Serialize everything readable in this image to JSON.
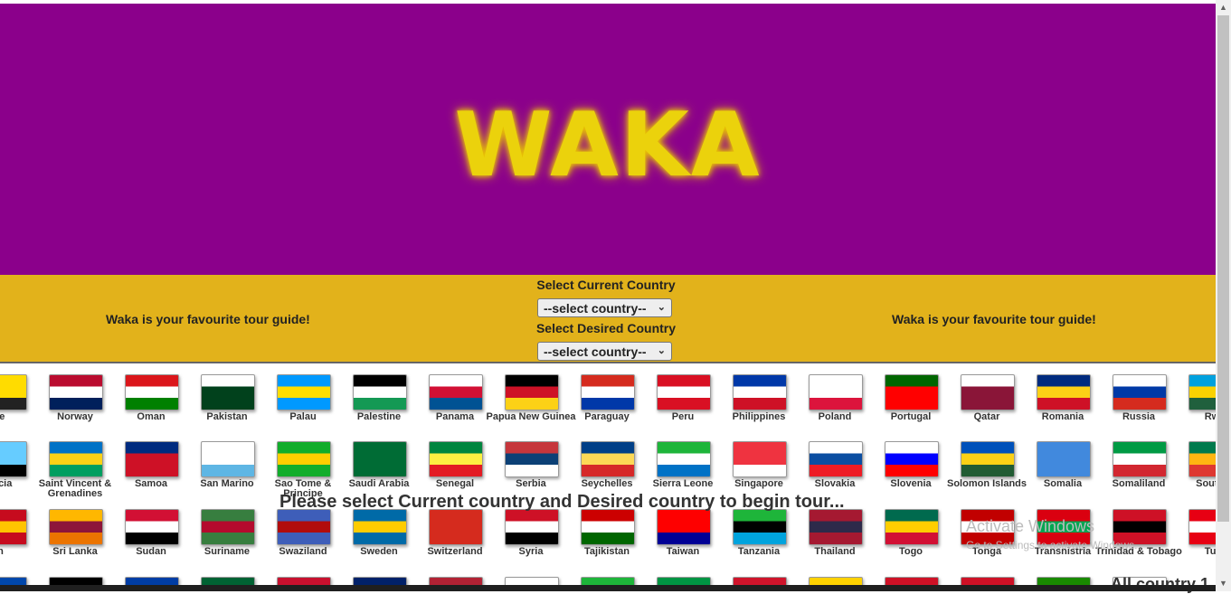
{
  "banner": {
    "logo": "WAKA",
    "background": "#8b008b",
    "logo_color": "#ebd20c"
  },
  "bar": {
    "tagline_left": "Waka is your favourite tour guide!",
    "tagline_right": "Waka is your favourite tour guide!",
    "current_label": "Select Current Country",
    "current_value": "--select country--",
    "desired_label": "Select Desired Country",
    "desired_value": "--select country--",
    "background": "#e2b21b"
  },
  "rows": [
    [
      {
        "name": "ue",
        "colors": [
          "#ffdc00",
          "#ffdc00",
          "#222"
        ]
      },
      {
        "name": "Norway",
        "colors": [
          "#ba0c2f",
          "#ffffff",
          "#00205b"
        ]
      },
      {
        "name": "Oman",
        "colors": [
          "#db161b",
          "#ffffff",
          "#008000"
        ]
      },
      {
        "name": "Pakistan",
        "colors": [
          "#ffffff",
          "#01411c",
          "#01411c"
        ]
      },
      {
        "name": "Palau",
        "colors": [
          "#0099ff",
          "#ffde00",
          "#0099ff"
        ]
      },
      {
        "name": "Palestine",
        "colors": [
          "#000000",
          "#ffffff",
          "#149954"
        ]
      },
      {
        "name": "Panama",
        "colors": [
          "#ffffff",
          "#d21034",
          "#005293"
        ]
      },
      {
        "name": "Papua New Guinea",
        "colors": [
          "#000000",
          "#ce1126",
          "#fcd116"
        ]
      },
      {
        "name": "Paraguay",
        "colors": [
          "#d52b1e",
          "#ffffff",
          "#0038a8"
        ]
      },
      {
        "name": "Peru",
        "colors": [
          "#d91023",
          "#ffffff",
          "#d91023"
        ]
      },
      {
        "name": "Philippines",
        "colors": [
          "#0038a8",
          "#ffffff",
          "#ce1126"
        ]
      },
      {
        "name": "Poland",
        "colors": [
          "#ffffff",
          "#ffffff",
          "#dc143c"
        ]
      },
      {
        "name": "Portugal",
        "colors": [
          "#006600",
          "#ff0000",
          "#ff0000"
        ]
      },
      {
        "name": "Qatar",
        "colors": [
          "#ffffff",
          "#8a1538",
          "#8a1538"
        ]
      },
      {
        "name": "Romania",
        "colors": [
          "#002b7f",
          "#fcd116",
          "#ce1126"
        ]
      },
      {
        "name": "Russia",
        "colors": [
          "#ffffff",
          "#0039a6",
          "#d52b1e"
        ]
      },
      {
        "name": "Rwa",
        "colors": [
          "#00a1de",
          "#fad201",
          "#20603d"
        ]
      }
    ],
    [
      {
        "name": "Lucia",
        "colors": [
          "#66ccff",
          "#66ccff",
          "#000"
        ]
      },
      {
        "name": "Saint Vincent & Grenadines",
        "colors": [
          "#0072c6",
          "#fcd116",
          "#009e60"
        ]
      },
      {
        "name": "Samoa",
        "colors": [
          "#002b7f",
          "#ce1126",
          "#ce1126"
        ]
      },
      {
        "name": "San Marino",
        "colors": [
          "#ffffff",
          "#ffffff",
          "#5eb6e4"
        ]
      },
      {
        "name": "Sao Tome & Principe",
        "colors": [
          "#12ad2b",
          "#ffce00",
          "#12ad2b"
        ]
      },
      {
        "name": "Saudi Arabia",
        "colors": [
          "#006c35",
          "#006c35",
          "#006c35"
        ]
      },
      {
        "name": "Senegal",
        "colors": [
          "#00853f",
          "#fdef42",
          "#e31b23"
        ]
      },
      {
        "name": "Serbia",
        "colors": [
          "#c6363c",
          "#0c4076",
          "#ffffff"
        ]
      },
      {
        "name": "Seychelles",
        "colors": [
          "#003f87",
          "#fcd856",
          "#d62828"
        ]
      },
      {
        "name": "Sierra Leone",
        "colors": [
          "#1eb53a",
          "#ffffff",
          "#0072c6"
        ]
      },
      {
        "name": "Singapore",
        "colors": [
          "#ef3340",
          "#ef3340",
          "#ffffff"
        ]
      },
      {
        "name": "Slovakia",
        "colors": [
          "#ffffff",
          "#0b4ea2",
          "#ee1c25"
        ]
      },
      {
        "name": "Slovenia",
        "colors": [
          "#ffffff",
          "#0000ff",
          "#ff0000"
        ]
      },
      {
        "name": "Solomon Islands",
        "colors": [
          "#0051ba",
          "#fcd116",
          "#215b33"
        ]
      },
      {
        "name": "Somalia",
        "colors": [
          "#4189dd",
          "#4189dd",
          "#4189dd"
        ]
      },
      {
        "name": "Somaliland",
        "colors": [
          "#009a44",
          "#ffffff",
          "#d22730"
        ]
      },
      {
        "name": "South A",
        "colors": [
          "#007a4d",
          "#ffb612",
          "#de3831"
        ]
      }
    ],
    [
      {
        "name": "in",
        "colors": [
          "#c60b1e",
          "#ffc400",
          "#c60b1e"
        ]
      },
      {
        "name": "Sri Lanka",
        "colors": [
          "#ffb700",
          "#8d153a",
          "#eb7400"
        ]
      },
      {
        "name": "Sudan",
        "colors": [
          "#d21034",
          "#ffffff",
          "#000000"
        ]
      },
      {
        "name": "Suriname",
        "colors": [
          "#377e3f",
          "#b40a2d",
          "#377e3f"
        ]
      },
      {
        "name": "Swaziland",
        "colors": [
          "#3e5eb9",
          "#b10c0c",
          "#3e5eb9"
        ]
      },
      {
        "name": "Sweden",
        "colors": [
          "#006aa7",
          "#fecc00",
          "#006aa7"
        ]
      },
      {
        "name": "Switzerland",
        "colors": [
          "#d52b1e",
          "#d52b1e",
          "#d52b1e"
        ]
      },
      {
        "name": "Syria",
        "colors": [
          "#ce1126",
          "#ffffff",
          "#000000"
        ]
      },
      {
        "name": "Tajikistan",
        "colors": [
          "#cc0000",
          "#ffffff",
          "#006600"
        ]
      },
      {
        "name": "Taiwan",
        "colors": [
          "#fe0000",
          "#fe0000",
          "#000095"
        ]
      },
      {
        "name": "Tanzania",
        "colors": [
          "#1eb53a",
          "#000000",
          "#00a3dd"
        ]
      },
      {
        "name": "Thailand",
        "colors": [
          "#a51931",
          "#2d2a4a",
          "#a51931"
        ]
      },
      {
        "name": "Togo",
        "colors": [
          "#006a4e",
          "#ffce00",
          "#d21034"
        ]
      },
      {
        "name": "Tonga",
        "colors": [
          "#c10000",
          "#ffffff",
          "#c10000"
        ]
      },
      {
        "name": "Transnistria",
        "colors": [
          "#da0010",
          "#00a651",
          "#da0010"
        ]
      },
      {
        "name": "Trinidad & Tobago",
        "colors": [
          "#ce1126",
          "#000000",
          "#ce1126"
        ]
      },
      {
        "name": "Tuni",
        "colors": [
          "#e70013",
          "#ffffff",
          "#e70013"
        ]
      }
    ]
  ],
  "partial_row": [
    {
      "colors": [
        "#0047ab",
        "#ffd700"
      ]
    },
    {
      "colors": [
        "#000",
        "#ffd700"
      ]
    },
    {
      "colors": [
        "#003da5",
        "#fff"
      ]
    },
    {
      "colors": [
        "#006233",
        "#c8102e"
      ]
    },
    {
      "colors": [
        "#c8102e",
        "#fff"
      ]
    },
    {
      "colors": [
        "#012169",
        "#c8102e"
      ]
    },
    {
      "colors": [
        "#b22234",
        "#3c3b6e"
      ]
    },
    {
      "colors": [
        "#fff",
        "#0038a8"
      ]
    },
    {
      "colors": [
        "#1eb53a",
        "#0099b5"
      ]
    },
    {
      "colors": [
        "#009543",
        "#ce1126"
      ]
    },
    {
      "colors": [
        "#cf142b",
        "#f7d116"
      ]
    },
    {
      "colors": [
        "#ffd200",
        "#fff"
      ]
    },
    {
      "colors": [
        "#ce1126",
        "#fcd116"
      ]
    },
    {
      "colors": [
        "#ce1126",
        "#fff"
      ]
    },
    {
      "colors": [
        "#198a00",
        "#ef7d00"
      ]
    },
    {
      "colors": [
        "#fff",
        "#000"
      ]
    }
  ],
  "prompt": "Please select Current country and Desired country to begin tour...",
  "watermark": {
    "line1": "Activate Windows",
    "line2": "Go to Settings to activate Windows."
  },
  "footer_text": "All country 1"
}
